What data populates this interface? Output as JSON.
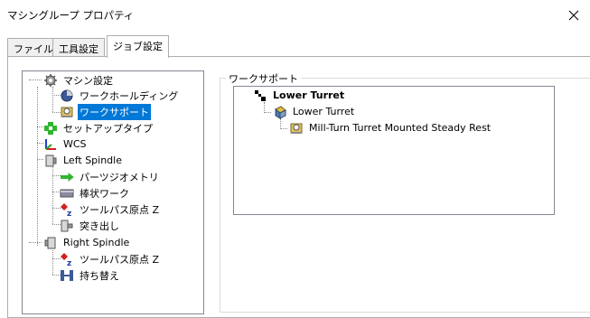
{
  "window": {
    "title": "マシングループ プロパティ"
  },
  "tabs": [
    {
      "label": "ファイル"
    },
    {
      "label": "工具設定"
    },
    {
      "label": "ジョブ設定"
    }
  ],
  "left_tree": {
    "items": [
      {
        "label": "マシン設定",
        "icon": "gear-icon"
      },
      {
        "label": "ワークホールディング",
        "icon": "chuck-icon"
      },
      {
        "label": "ワークサポート",
        "icon": "steady-rest-icon"
      },
      {
        "label": "セットアップタイプ",
        "icon": "setup-type-icon"
      },
      {
        "label": "WCS",
        "icon": "axes-icon"
      },
      {
        "label": "Left Spindle",
        "icon": "spindle-icon"
      },
      {
        "label": "パーツジオメトリ",
        "icon": "green-arrow-icon"
      },
      {
        "label": "棒状ワーク",
        "icon": "bar-stock-icon"
      },
      {
        "label": "ツールパス原点 Z",
        "icon": "toolpath-origin-icon"
      },
      {
        "label": "突き出し",
        "icon": "stickout-icon"
      },
      {
        "label": "Right Spindle",
        "icon": "spindle-icon"
      },
      {
        "label": "ツールパス原点 Z",
        "icon": "toolpath-origin-icon"
      },
      {
        "label": "持ち替え",
        "icon": "transfer-icon"
      }
    ]
  },
  "work_support": {
    "group_label": "ワークサポート",
    "items": [
      {
        "label": "Lower Turret",
        "icon": "turret-icon"
      },
      {
        "label": "Lower Turret",
        "icon": "turret-block-icon"
      },
      {
        "label": "Mill-Turn Turret Mounted Steady Rest",
        "icon": "steady-rest-icon"
      }
    ]
  },
  "colors": {
    "selection": "#0078d7",
    "border": "#828790",
    "tab_border": "#adadad"
  }
}
